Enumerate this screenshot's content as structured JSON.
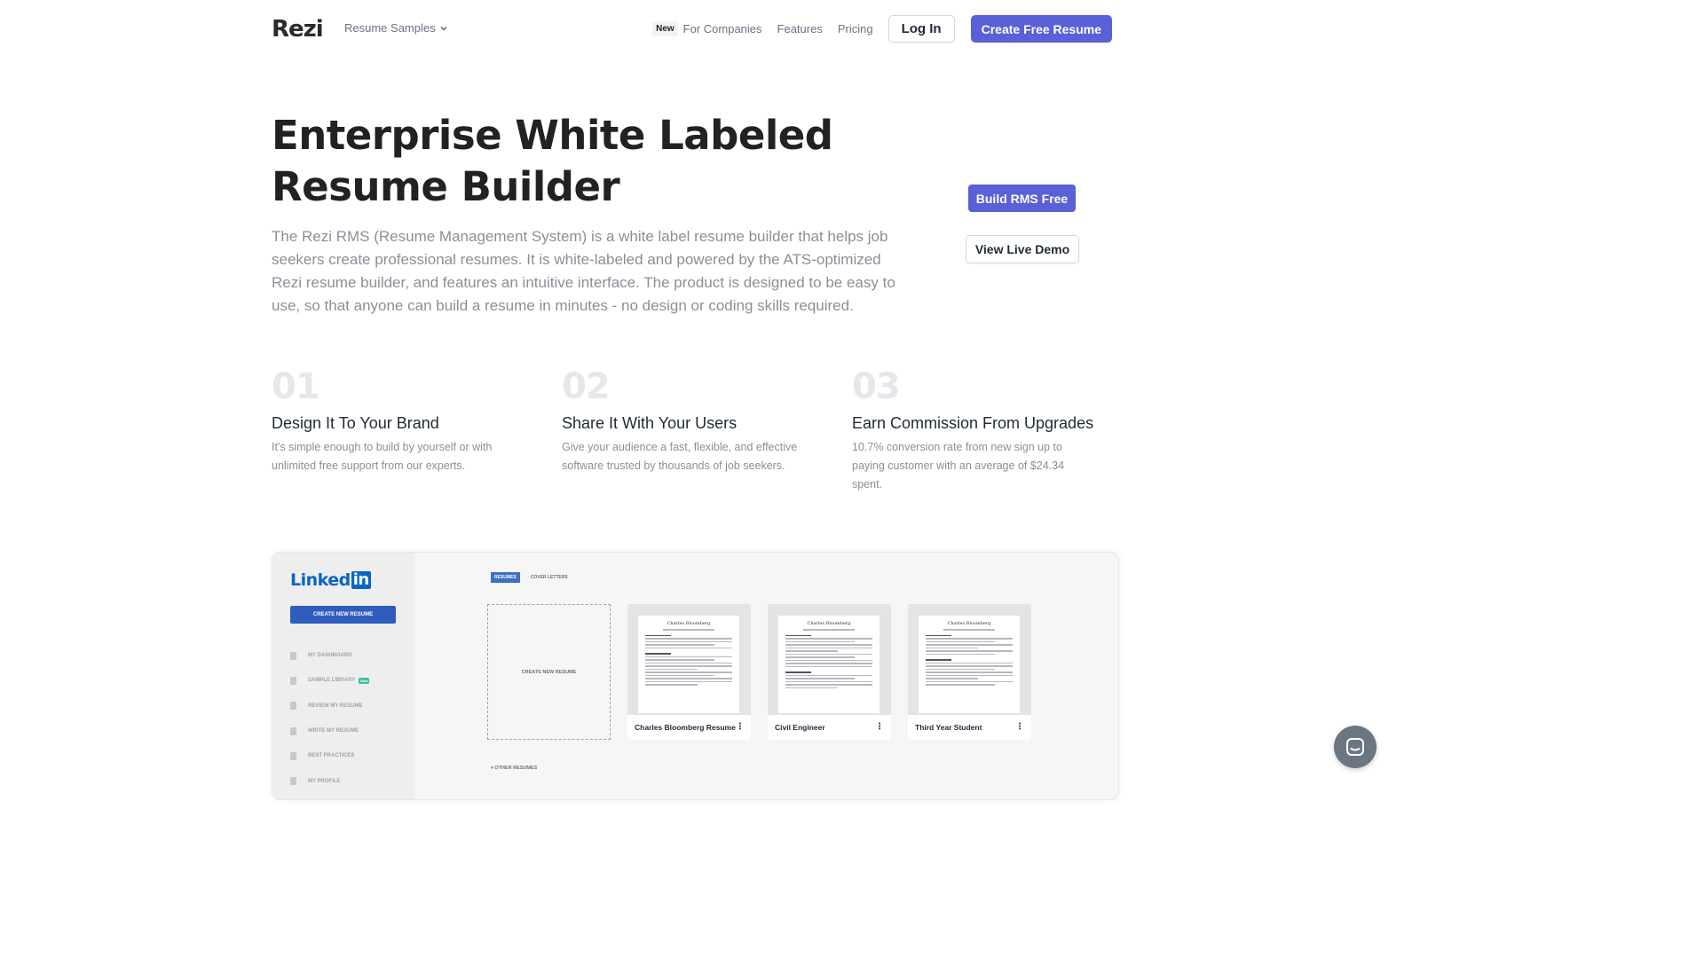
{
  "nav": {
    "logo": "Rezi",
    "samples": "Resume Samples",
    "new_badge": "New",
    "for_companies": "For Companies",
    "features": "Features",
    "pricing": "Pricing",
    "login": "Log In",
    "create": "Create Free Resume"
  },
  "hero": {
    "title_line1": "Enterprise White Labeled",
    "title_line2": "Resume Builder",
    "description": "The Rezi RMS (Resume Management System) is a white label resume builder that helps job seekers create professional resumes. It is white-labeled and powered by the ATS-optimized Rezi resume builder, and features an intuitive interface. The product is designed to be easy to use, so that anyone can build a resume in minutes - no design or coding skills required.",
    "build_rms": "Build RMS Free",
    "view_demo": "View Live Demo"
  },
  "features": [
    {
      "num": "01",
      "title": "Design It To Your Brand",
      "desc": "It's simple enough to build by yourself or with unlimited free support from our experts."
    },
    {
      "num": "02",
      "title": "Share It With Your Users",
      "desc": "Give your audience a fast, flexible, and effective software trusted by thousands of job seekers."
    },
    {
      "num": "03",
      "title": "Earn Commission From Upgrades",
      "desc": "10.7% conversion rate from new sign up to paying customer with an average of $24.34 spent."
    }
  ],
  "preview": {
    "logo_text": "Linked",
    "logo_in": "in",
    "create_btn": "CREATE NEW RESUME",
    "menu": [
      {
        "label": "MY DASHBOARD"
      },
      {
        "label": "SAMPLE LIBRARY",
        "badge": "New"
      },
      {
        "label": "REVIEW MY RESUME"
      },
      {
        "label": "WRITE MY RESUME"
      },
      {
        "label": "BEST PRACTICES"
      },
      {
        "label": "MY PROFILE"
      }
    ],
    "tab_resumes": "RESUMES",
    "tab_cover": "COVER LETTERS",
    "new_card": "CREATE NEW RESUME",
    "cards": [
      {
        "name": "Charles Bloomberg Resume",
        "paper_name": "Charles Bloomberg"
      },
      {
        "name": "Civil Engineer",
        "paper_name": "Charles Bloomberg"
      },
      {
        "name": "Third Year Student",
        "paper_name": "Charles Bloomberg"
      }
    ],
    "other": "OTHER RESUMES"
  },
  "icons": {
    "chevron": "chevron-down-icon",
    "chat": "chat-bubble-icon"
  },
  "colors": {
    "accent": "#5a60d6",
    "linkedin": "#0a66c2"
  }
}
